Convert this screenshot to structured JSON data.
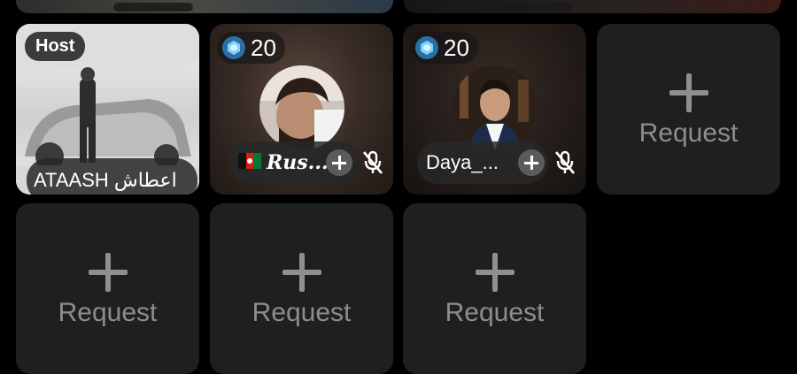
{
  "host": {
    "badge": "Host",
    "name": "ATAASH اعطاش"
  },
  "guests": [
    {
      "gem_count": "20",
      "name": "Rus...",
      "flag_icon": "afghanistan-flag-icon",
      "muted": true
    },
    {
      "gem_count": "20",
      "name": "Daya_...",
      "muted": true
    }
  ],
  "empty_seat": {
    "label": "Request"
  },
  "colors": {
    "background": "#000000",
    "tile": "#1f1f1f",
    "gem": "#4fb4e8",
    "text": "#ffffff",
    "request_text": "#8d8d8d"
  }
}
